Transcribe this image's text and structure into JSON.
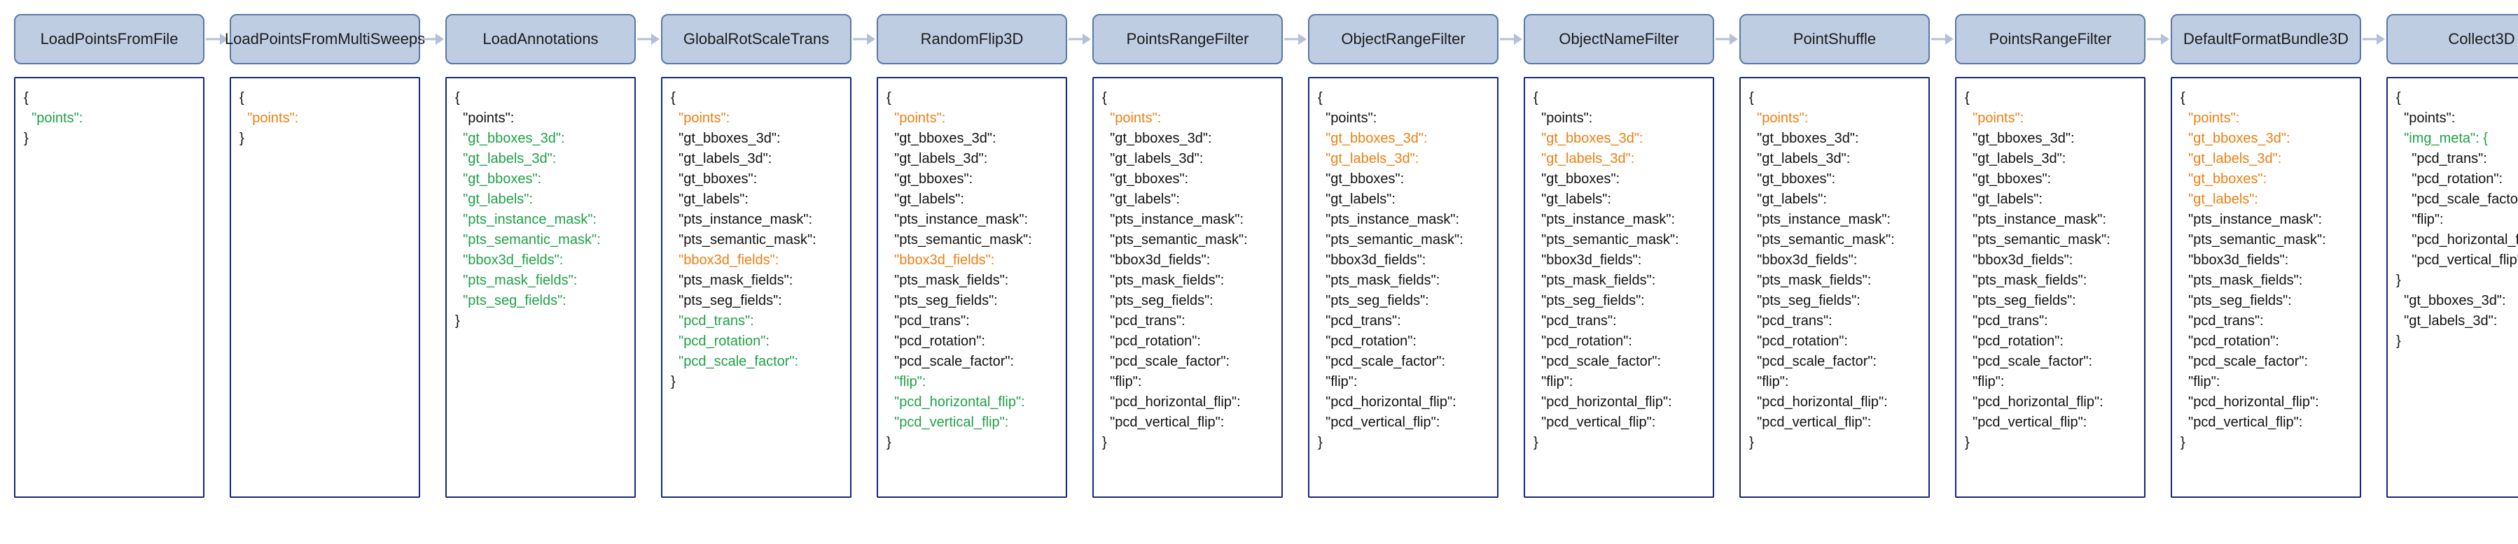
{
  "colors": {
    "green": "#1fa147",
    "orange": "#ec7f12",
    "black": "#111111"
  },
  "stages": [
    {
      "name": "LoadPointsFromFile",
      "keys": [
        {
          "text": "\"points\":",
          "color": "green"
        }
      ]
    },
    {
      "name": "LoadPointsFrom\nMultiSweeps",
      "keys": [
        {
          "text": "\"points\":",
          "color": "orange"
        }
      ]
    },
    {
      "name": "LoadAnnotations",
      "keys": [
        {
          "text": "\"points\":",
          "color": "black"
        },
        {
          "text": "\"gt_bboxes_3d\":",
          "color": "green"
        },
        {
          "text": "\"gt_labels_3d\":",
          "color": "green"
        },
        {
          "text": "\"gt_bboxes\":",
          "color": "green"
        },
        {
          "text": "\"gt_labels\":",
          "color": "green"
        },
        {
          "text": "\"pts_instance_mask\":",
          "color": "green"
        },
        {
          "text": "\"pts_semantic_mask\":",
          "color": "green"
        },
        {
          "text": "\"bbox3d_fields\":",
          "color": "green"
        },
        {
          "text": "\"pts_mask_fields\":",
          "color": "green"
        },
        {
          "text": "\"pts_seg_fields\":",
          "color": "green"
        }
      ]
    },
    {
      "name": "GlobalRotScaleTrans",
      "keys": [
        {
          "text": "\"points\":",
          "color": "orange"
        },
        {
          "text": "\"gt_bboxes_3d\":",
          "color": "black"
        },
        {
          "text": "\"gt_labels_3d\":",
          "color": "black"
        },
        {
          "text": "\"gt_bboxes\":",
          "color": "black"
        },
        {
          "text": "\"gt_labels\":",
          "color": "black"
        },
        {
          "text": "\"pts_instance_mask\":",
          "color": "black"
        },
        {
          "text": "\"pts_semantic_mask\":",
          "color": "black"
        },
        {
          "text": "\"bbox3d_fields\":",
          "color": "orange"
        },
        {
          "text": "\"pts_mask_fields\":",
          "color": "black"
        },
        {
          "text": "\"pts_seg_fields\":",
          "color": "black"
        },
        {
          "text": "\"pcd_trans\":",
          "color": "green"
        },
        {
          "text": "\"pcd_rotation\":",
          "color": "green"
        },
        {
          "text": "\"pcd_scale_factor\":",
          "color": "green"
        }
      ]
    },
    {
      "name": "RandomFlip3D",
      "keys": [
        {
          "text": "\"points\":",
          "color": "orange"
        },
        {
          "text": "\"gt_bboxes_3d\":",
          "color": "black"
        },
        {
          "text": "\"gt_labels_3d\":",
          "color": "black"
        },
        {
          "text": "\"gt_bboxes\":",
          "color": "black"
        },
        {
          "text": "\"gt_labels\":",
          "color": "black"
        },
        {
          "text": "\"pts_instance_mask\":",
          "color": "black"
        },
        {
          "text": "\"pts_semantic_mask\":",
          "color": "black"
        },
        {
          "text": "\"bbox3d_fields\":",
          "color": "orange"
        },
        {
          "text": "\"pts_mask_fields\":",
          "color": "black"
        },
        {
          "text": "\"pts_seg_fields\":",
          "color": "black"
        },
        {
          "text": "\"pcd_trans\":",
          "color": "black"
        },
        {
          "text": "\"pcd_rotation\":",
          "color": "black"
        },
        {
          "text": "\"pcd_scale_factor\":",
          "color": "black"
        },
        {
          "text": "\"flip\":",
          "color": "green"
        },
        {
          "text": "\"pcd_horizontal_flip\":",
          "color": "green"
        },
        {
          "text": "\"pcd_vertical_flip\":",
          "color": "green"
        }
      ]
    },
    {
      "name": "PointsRangeFilter",
      "keys": [
        {
          "text": "\"points\":",
          "color": "orange"
        },
        {
          "text": "\"gt_bboxes_3d\":",
          "color": "black"
        },
        {
          "text": "\"gt_labels_3d\":",
          "color": "black"
        },
        {
          "text": "\"gt_bboxes\":",
          "color": "black"
        },
        {
          "text": "\"gt_labels\":",
          "color": "black"
        },
        {
          "text": "\"pts_instance_mask\":",
          "color": "black"
        },
        {
          "text": "\"pts_semantic_mask\":",
          "color": "black"
        },
        {
          "text": "\"bbox3d_fields\":",
          "color": "black"
        },
        {
          "text": "\"pts_mask_fields\":",
          "color": "black"
        },
        {
          "text": "\"pts_seg_fields\":",
          "color": "black"
        },
        {
          "text": "\"pcd_trans\":",
          "color": "black"
        },
        {
          "text": "\"pcd_rotation\":",
          "color": "black"
        },
        {
          "text": "\"pcd_scale_factor\":",
          "color": "black"
        },
        {
          "text": "\"flip\":",
          "color": "black"
        },
        {
          "text": "\"pcd_horizontal_flip\":",
          "color": "black"
        },
        {
          "text": "\"pcd_vertical_flip\":",
          "color": "black"
        }
      ]
    },
    {
      "name": "ObjectRangeFilter",
      "keys": [
        {
          "text": "\"points\":",
          "color": "black"
        },
        {
          "text": "\"gt_bboxes_3d\":",
          "color": "orange"
        },
        {
          "text": "\"gt_labels_3d\":",
          "color": "orange"
        },
        {
          "text": "\"gt_bboxes\":",
          "color": "black"
        },
        {
          "text": "\"gt_labels\":",
          "color": "black"
        },
        {
          "text": "\"pts_instance_mask\":",
          "color": "black"
        },
        {
          "text": "\"pts_semantic_mask\":",
          "color": "black"
        },
        {
          "text": "\"bbox3d_fields\":",
          "color": "black"
        },
        {
          "text": "\"pts_mask_fields\":",
          "color": "black"
        },
        {
          "text": "\"pts_seg_fields\":",
          "color": "black"
        },
        {
          "text": "\"pcd_trans\":",
          "color": "black"
        },
        {
          "text": "\"pcd_rotation\":",
          "color": "black"
        },
        {
          "text": "\"pcd_scale_factor\":",
          "color": "black"
        },
        {
          "text": "\"flip\":",
          "color": "black"
        },
        {
          "text": "\"pcd_horizontal_flip\":",
          "color": "black"
        },
        {
          "text": "\"pcd_vertical_flip\":",
          "color": "black"
        }
      ]
    },
    {
      "name": "ObjectNameFilter",
      "keys": [
        {
          "text": "\"points\":",
          "color": "black"
        },
        {
          "text": "\"gt_bboxes_3d\":",
          "color": "orange"
        },
        {
          "text": "\"gt_labels_3d\":",
          "color": "orange"
        },
        {
          "text": "\"gt_bboxes\":",
          "color": "black"
        },
        {
          "text": "\"gt_labels\":",
          "color": "black"
        },
        {
          "text": "\"pts_instance_mask\":",
          "color": "black"
        },
        {
          "text": "\"pts_semantic_mask\":",
          "color": "black"
        },
        {
          "text": "\"bbox3d_fields\":",
          "color": "black"
        },
        {
          "text": "\"pts_mask_fields\":",
          "color": "black"
        },
        {
          "text": "\"pts_seg_fields\":",
          "color": "black"
        },
        {
          "text": "\"pcd_trans\":",
          "color": "black"
        },
        {
          "text": "\"pcd_rotation\":",
          "color": "black"
        },
        {
          "text": "\"pcd_scale_factor\":",
          "color": "black"
        },
        {
          "text": "\"flip\":",
          "color": "black"
        },
        {
          "text": "\"pcd_horizontal_flip\":",
          "color": "black"
        },
        {
          "text": "\"pcd_vertical_flip\":",
          "color": "black"
        }
      ]
    },
    {
      "name": "PointShuffle",
      "keys": [
        {
          "text": "\"points\":",
          "color": "orange"
        },
        {
          "text": "\"gt_bboxes_3d\":",
          "color": "black"
        },
        {
          "text": "\"gt_labels_3d\":",
          "color": "black"
        },
        {
          "text": "\"gt_bboxes\":",
          "color": "black"
        },
        {
          "text": "\"gt_labels\":",
          "color": "black"
        },
        {
          "text": "\"pts_instance_mask\":",
          "color": "black"
        },
        {
          "text": "\"pts_semantic_mask\":",
          "color": "black"
        },
        {
          "text": "\"bbox3d_fields\":",
          "color": "black"
        },
        {
          "text": "\"pts_mask_fields\":",
          "color": "black"
        },
        {
          "text": "\"pts_seg_fields\":",
          "color": "black"
        },
        {
          "text": "\"pcd_trans\":",
          "color": "black"
        },
        {
          "text": "\"pcd_rotation\":",
          "color": "black"
        },
        {
          "text": "\"pcd_scale_factor\":",
          "color": "black"
        },
        {
          "text": "\"flip\":",
          "color": "black"
        },
        {
          "text": "\"pcd_horizontal_flip\":",
          "color": "black"
        },
        {
          "text": "\"pcd_vertical_flip\":",
          "color": "black"
        }
      ]
    },
    {
      "name": "PointsRangeFilter",
      "keys": [
        {
          "text": "\"points\":",
          "color": "orange"
        },
        {
          "text": "\"gt_bboxes_3d\":",
          "color": "black"
        },
        {
          "text": "\"gt_labels_3d\":",
          "color": "black"
        },
        {
          "text": "\"gt_bboxes\":",
          "color": "black"
        },
        {
          "text": "\"gt_labels\":",
          "color": "black"
        },
        {
          "text": "\"pts_instance_mask\":",
          "color": "black"
        },
        {
          "text": "\"pts_semantic_mask\":",
          "color": "black"
        },
        {
          "text": "\"bbox3d_fields\":",
          "color": "black"
        },
        {
          "text": "\"pts_mask_fields\":",
          "color": "black"
        },
        {
          "text": "\"pts_seg_fields\":",
          "color": "black"
        },
        {
          "text": "\"pcd_trans\":",
          "color": "black"
        },
        {
          "text": "\"pcd_rotation\":",
          "color": "black"
        },
        {
          "text": "\"pcd_scale_factor\":",
          "color": "black"
        },
        {
          "text": "\"flip\":",
          "color": "black"
        },
        {
          "text": "\"pcd_horizontal_flip\":",
          "color": "black"
        },
        {
          "text": "\"pcd_vertical_flip\":",
          "color": "black"
        }
      ]
    },
    {
      "name": "DefaultFormat\nBundle3D",
      "keys": [
        {
          "text": "\"points\":",
          "color": "orange"
        },
        {
          "text": "\"gt_bboxes_3d\":",
          "color": "orange"
        },
        {
          "text": "\"gt_labels_3d\":",
          "color": "orange"
        },
        {
          "text": "\"gt_bboxes\":",
          "color": "orange"
        },
        {
          "text": "\"gt_labels\":",
          "color": "orange"
        },
        {
          "text": "\"pts_instance_mask\":",
          "color": "black"
        },
        {
          "text": "\"pts_semantic_mask\":",
          "color": "black"
        },
        {
          "text": "\"bbox3d_fields\":",
          "color": "black"
        },
        {
          "text": "\"pts_mask_fields\":",
          "color": "black"
        },
        {
          "text": "\"pts_seg_fields\":",
          "color": "black"
        },
        {
          "text": "\"pcd_trans\":",
          "color": "black"
        },
        {
          "text": "\"pcd_rotation\":",
          "color": "black"
        },
        {
          "text": "\"pcd_scale_factor\":",
          "color": "black"
        },
        {
          "text": "\"flip\":",
          "color": "black"
        },
        {
          "text": "\"pcd_horizontal_flip\":",
          "color": "black"
        },
        {
          "text": "\"pcd_vertical_flip\":",
          "color": "black"
        }
      ]
    },
    {
      "name": "Collect3D",
      "keys": [
        {
          "text": "\"points\":",
          "color": "black"
        },
        {
          "text": "\"img_meta\": {",
          "color": "green",
          "indent": 0
        },
        {
          "text": "\"pcd_trans\":",
          "color": "black",
          "indent": 1
        },
        {
          "text": "\"pcd_rotation\":",
          "color": "black",
          "indent": 1
        },
        {
          "text": "\"pcd_scale_factor\":",
          "color": "black",
          "indent": 1
        },
        {
          "text": "\"flip\":",
          "color": "black",
          "indent": 1
        },
        {
          "text": "\"pcd_horizontal_flip\":",
          "color": "black",
          "indent": 1
        },
        {
          "text": "\"pcd_vertical_flip\":",
          "color": "black",
          "indent": 1
        },
        {
          "text": "}",
          "color": "black",
          "indent": 0,
          "noIndentBase": true
        },
        {
          "text": "\"gt_bboxes_3d\":",
          "color": "black"
        },
        {
          "text": "\"gt_labels_3d\":",
          "color": "black"
        }
      ]
    }
  ]
}
